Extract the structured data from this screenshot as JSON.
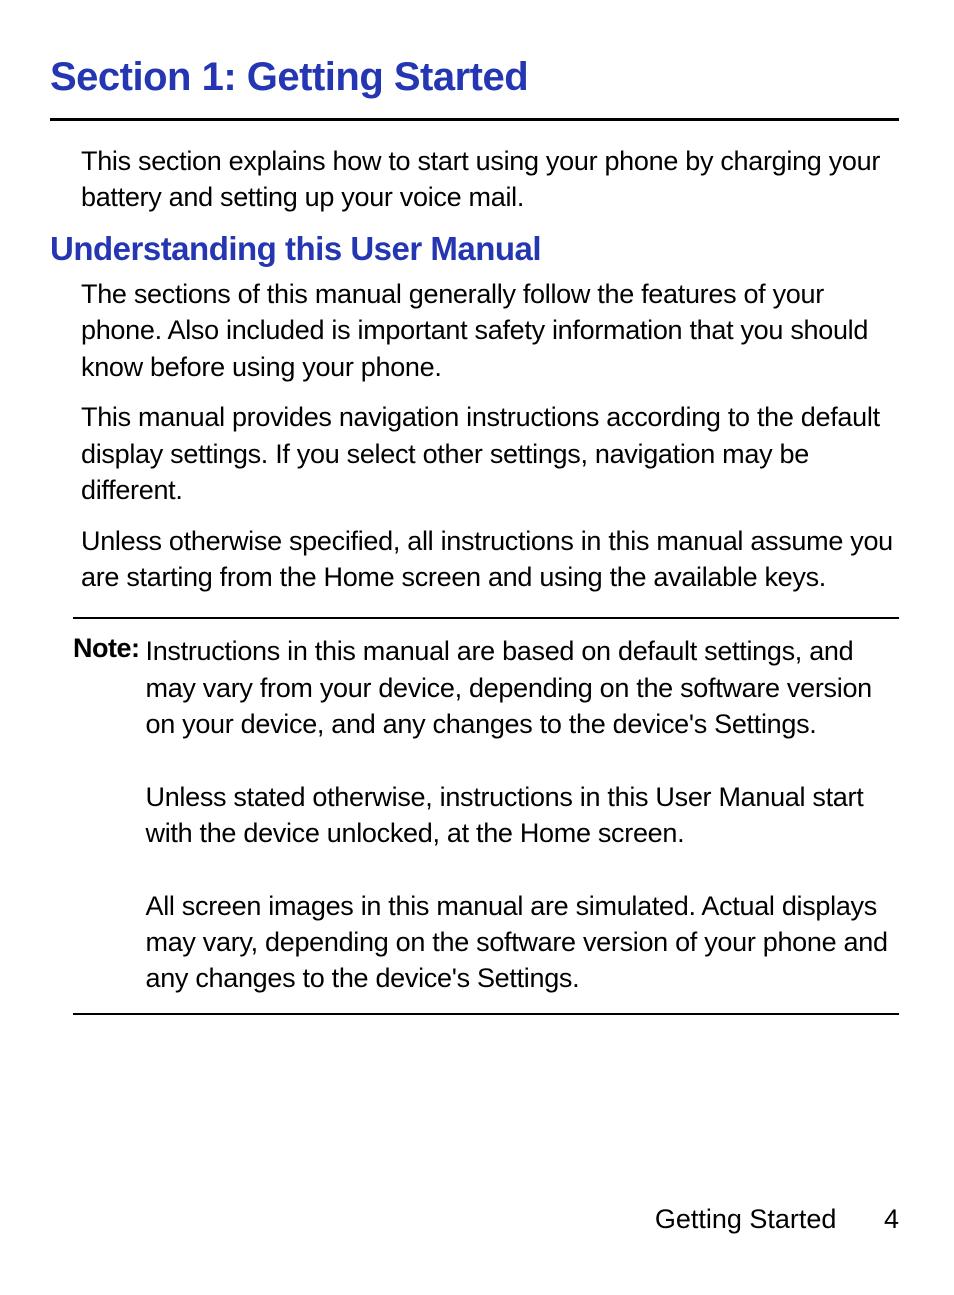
{
  "section": {
    "title": "Section 1: Getting Started",
    "intro": "This section explains how to start using your phone by charging your battery and setting up your voice mail."
  },
  "subsection": {
    "title": "Understanding this User Manual",
    "paragraphs": [
      "The sections of this manual generally follow the features of your phone. Also included is important safety information that you should know before using your phone.",
      "This manual provides navigation instructions according to the default display settings. If you select other settings, navigation may be different.",
      "Unless otherwise specified, all instructions in this manual assume you are starting from the Home screen and using the available keys."
    ]
  },
  "note": {
    "label": "Note:",
    "paragraphs": [
      "Instructions in this manual are based on default settings, and may vary from your device, depending on the software version on your device, and any changes to the device's Settings.",
      "Unless stated otherwise, instructions in this User Manual start with the device unlocked, at the Home screen.",
      "All screen images in this manual are simulated. Actual displays may vary, depending on the software version of your phone and any changes to the device's Settings."
    ]
  },
  "footer": {
    "label": "Getting Started",
    "page": "4"
  }
}
